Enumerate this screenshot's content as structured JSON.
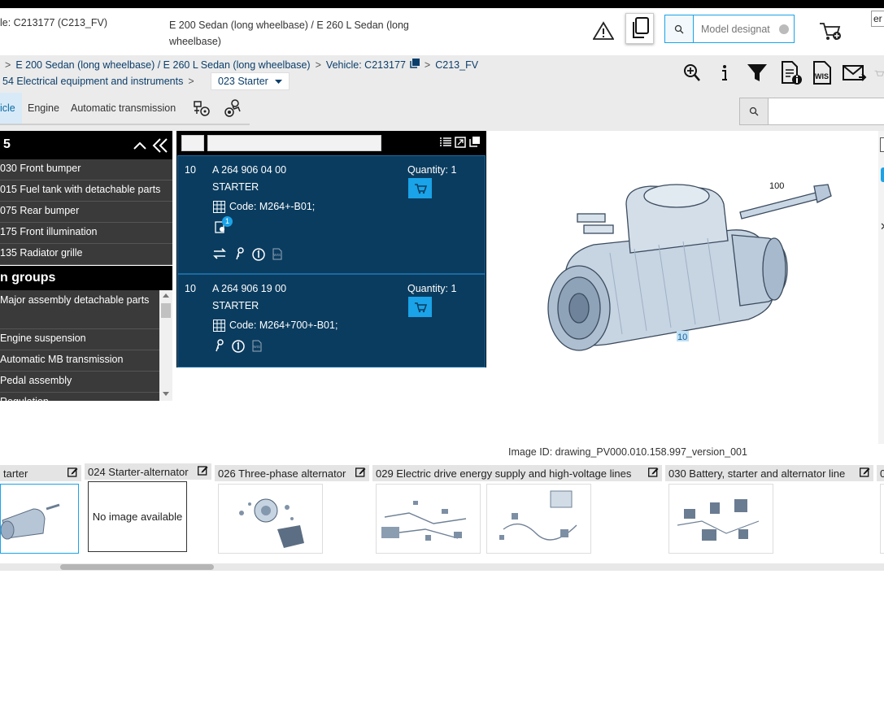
{
  "header": {
    "vehicle": "le: C213177 (C213_FV)",
    "model": "E 200 Sedan (long wheelbase) / E 260 L Sedan (long wheelbase)",
    "search_placeholder": "Model designat",
    "lang": "er"
  },
  "breadcrumb": {
    "line1": [
      ">",
      "E 200 Sedan (long wheelbase) / E 260 L Sedan (long wheelbase)",
      ">",
      "Vehicle: C213177",
      ">",
      "C213_FV"
    ],
    "group": "54 Electrical equipment and instruments",
    "subgroup": "023 Starter"
  },
  "tabs": [
    {
      "label": "icle",
      "active": true
    },
    {
      "label": "Engine",
      "active": false
    },
    {
      "label": "Automatic transmission",
      "active": false
    }
  ],
  "sidebar": {
    "header_number": "5",
    "items": [
      "030 Front bumper",
      "015 Fuel tank with detachable parts",
      "075 Rear bumper",
      "175 Front illumination",
      "135 Radiator grille"
    ],
    "groups_title": "n groups",
    "groups": [
      "Major assembly detachable parts",
      "Engine suspension",
      "Automatic MB transmission",
      "Pedal assembly",
      "Regulation"
    ]
  },
  "parts": [
    {
      "pos": "10",
      "number": "A 264 906 04 00",
      "name": "STARTER",
      "qty_label": "Quantity: 1",
      "code": "Code: M264+-B01;",
      "badge": "1"
    },
    {
      "pos": "10",
      "number": "A 264 906 19 00",
      "name": "STARTER",
      "qty_label": "Quantity: 1",
      "code": "Code: M264+700+-B01;"
    }
  ],
  "drawing": {
    "callout_bolt": "100",
    "callout_starter": "10",
    "image_id": "Image ID: drawing_PV000.010.158.997_version_001"
  },
  "thumbnails": [
    {
      "title": "tarter",
      "image": "starter"
    },
    {
      "title": "024 Starter-alternator",
      "image": "none",
      "none_text": "No image available"
    },
    {
      "title": "026 Three-phase alternator",
      "image": "alternator"
    },
    {
      "title": "029 Electric drive energy supply and high-voltage lines",
      "image": "wiring"
    },
    {
      "title": "030 Battery, starter and alternator line",
      "image": "battery"
    },
    {
      "title": "0",
      "image": "partial"
    }
  ],
  "colors": {
    "accent": "#1aa3e8",
    "part_bg": "#0a3c5f",
    "sidebar_bg": "#3a3a3a"
  }
}
